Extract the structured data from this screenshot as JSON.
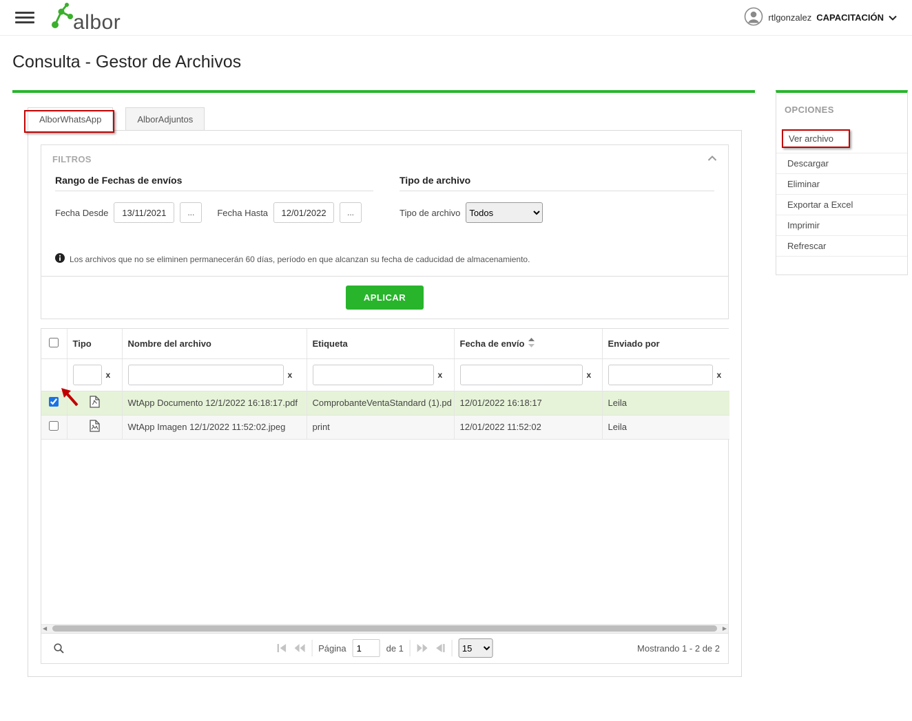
{
  "accent": {
    "green": "#28b52c",
    "annotation_red": "#c00000",
    "selected_row_bg": "#e6f3d8"
  },
  "topbar": {
    "logo_text": "albor",
    "user_name": "rtlgonzalez",
    "user_org": "CAPACITACIÓN"
  },
  "page_title": "Consulta - Gestor de Archivos",
  "tabs": [
    {
      "label": "AlborWhatsApp"
    },
    {
      "label": "AlborAdjuntos"
    }
  ],
  "filters": {
    "panel_title": "FILTROS",
    "date_section_title": "Rango de Fechas de envíos",
    "type_section_title": "Tipo de archivo",
    "fecha_desde_label": "Fecha Desde",
    "fecha_desde_value": "13/11/2021",
    "fecha_hasta_label": "Fecha Hasta",
    "fecha_hasta_value": "12/01/2022",
    "browse_label": "...",
    "tipo_archivo_label": "Tipo de archivo",
    "tipo_archivo_value": "Todos",
    "info_note": "Los archivos que no se eliminen permanecerán 60 días, período en que alcanzan su fecha de caducidad de almacenamiento.",
    "apply_label": "APLICAR"
  },
  "table": {
    "headers": {
      "tipo": "Tipo",
      "nombre": "Nombre del archivo",
      "etiqueta": "Etiqueta",
      "fecha": "Fecha de envío",
      "enviado": "Enviado por"
    },
    "filter_clear": "x",
    "filter_values": {
      "tipo": "",
      "nombre": "",
      "etiqueta": "",
      "fecha": "",
      "enviado": ""
    },
    "rows": [
      {
        "checked": true,
        "type_icon": "pdf-file-icon",
        "nombre": "WtApp Documento 12/1/2022 16:18:17.pdf",
        "etiqueta": "ComprobanteVentaStandard (1).pd",
        "fecha": "12/01/2022 16:18:17",
        "enviado": "Leila"
      },
      {
        "checked": false,
        "type_icon": "image-file-icon",
        "nombre": "WtApp Imagen 12/1/2022 11:52:02.jpeg",
        "etiqueta": "print",
        "fecha": "12/01/2022 11:52:02",
        "enviado": "Leila"
      }
    ]
  },
  "pagination": {
    "page_label": "Página",
    "page_value": "1",
    "of_label": "de 1",
    "page_size_value": "15",
    "status": "Mostrando 1 - 2 de 2"
  },
  "options": {
    "title": "OPCIONES",
    "items": [
      "Ver archivo",
      "Descargar",
      "Eliminar",
      "Exportar a Excel",
      "Imprimir",
      "Refrescar"
    ]
  }
}
